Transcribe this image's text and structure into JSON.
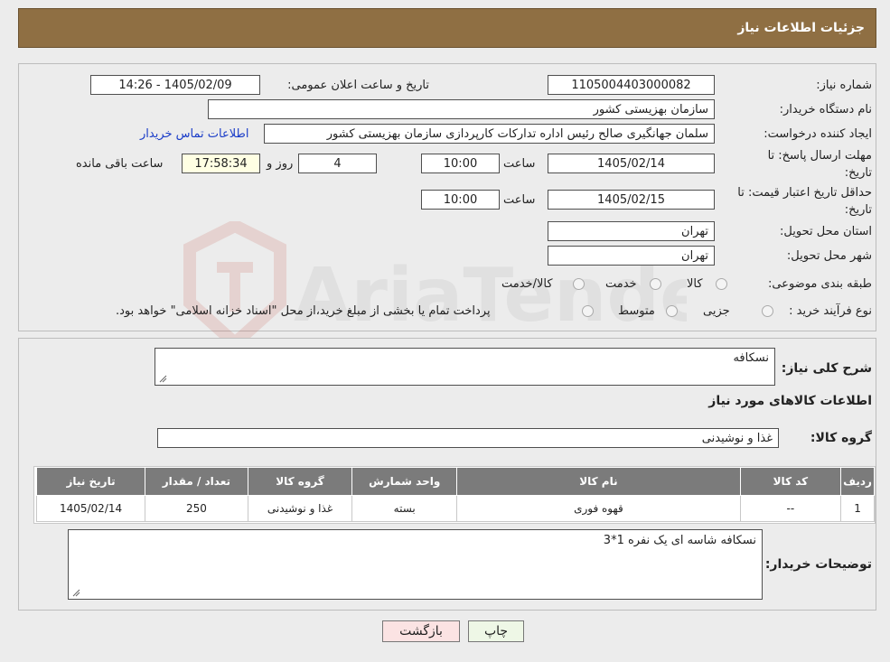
{
  "header": {
    "title": "جزئیات اطلاعات نیاز"
  },
  "watermark": {
    "text": "AriaTender.neT"
  },
  "form": {
    "need_number_label": "شماره نیاز:",
    "need_number": "1105004403000082",
    "announce_label": "تاریخ و ساعت اعلان عمومی:",
    "announce_value": "1405/02/09 - 14:26",
    "buyer_org_label": "نام دستگاه خریدار:",
    "buyer_org": "سازمان بهزیستی کشور",
    "creator_label": "ایجاد کننده درخواست:",
    "creator": "سلمان جهانگیری صالح رئیس اداره تدارکات کارپردازی سازمان بهزیستی کشور",
    "contact_link": "اطلاعات تماس خریدار",
    "deadline_label_1": "مهلت ارسال پاسخ: تا",
    "deadline_label_2": "تاریخ:",
    "deadline_date": "1405/02/14",
    "time_label": "ساعت",
    "deadline_time": "10:00",
    "days": "4",
    "days_label": "روز و",
    "remaining_time": "17:58:34",
    "remaining_label": "ساعت باقی مانده",
    "validity_label_1": "حداقل تاریخ اعتبار قیمت: تا",
    "validity_label_2": "تاریخ:",
    "validity_date": "1405/02/15",
    "validity_time": "10:00",
    "province_label": "استان محل تحویل:",
    "province": "تهران",
    "city_label": "شهر محل تحویل:",
    "city": "تهران",
    "category_label": "طبقه بندی موضوعی:",
    "category_options": [
      "کالا",
      "خدمت",
      "کالا/خدمت"
    ],
    "process_label": "نوع فرآیند خرید :",
    "process_options": [
      "جزیی",
      "متوسط"
    ],
    "process_note": "پرداخت تمام یا بخشی از مبلغ خرید،از محل \"اسناد خزانه اسلامی\" خواهد بود."
  },
  "details": {
    "summary_label": "شرح کلی نیاز:",
    "summary": "نسکافه",
    "goods_info_title": "اطلاعات کالاهای مورد نیاز",
    "goods_group_label": "گروه کالا:",
    "goods_group": "غذا و نوشیدنی",
    "table": {
      "headers": [
        "ردیف",
        "کد کالا",
        "نام کالا",
        "واحد شمارش",
        "گروه کالا",
        "تعداد / مقدار",
        "تاریخ نیاز"
      ],
      "rows": [
        [
          "1",
          "--",
          "قهوه فوری",
          "بسته",
          "غذا و نوشیدنی",
          "250",
          "1405/02/14"
        ]
      ]
    },
    "buyer_notes_label": "توضیحات خریدار:",
    "buyer_notes": "نسکافه شاسه ای یک نفره 1*3"
  },
  "buttons": {
    "print": "چاپ",
    "back": "بازگشت"
  },
  "colors": {
    "header": "#8f6f43",
    "table_header": "#7b7b7b",
    "print_btn": "#eef7e6",
    "back_btn": "#fbe3e3",
    "link": "#1a3cc8"
  }
}
